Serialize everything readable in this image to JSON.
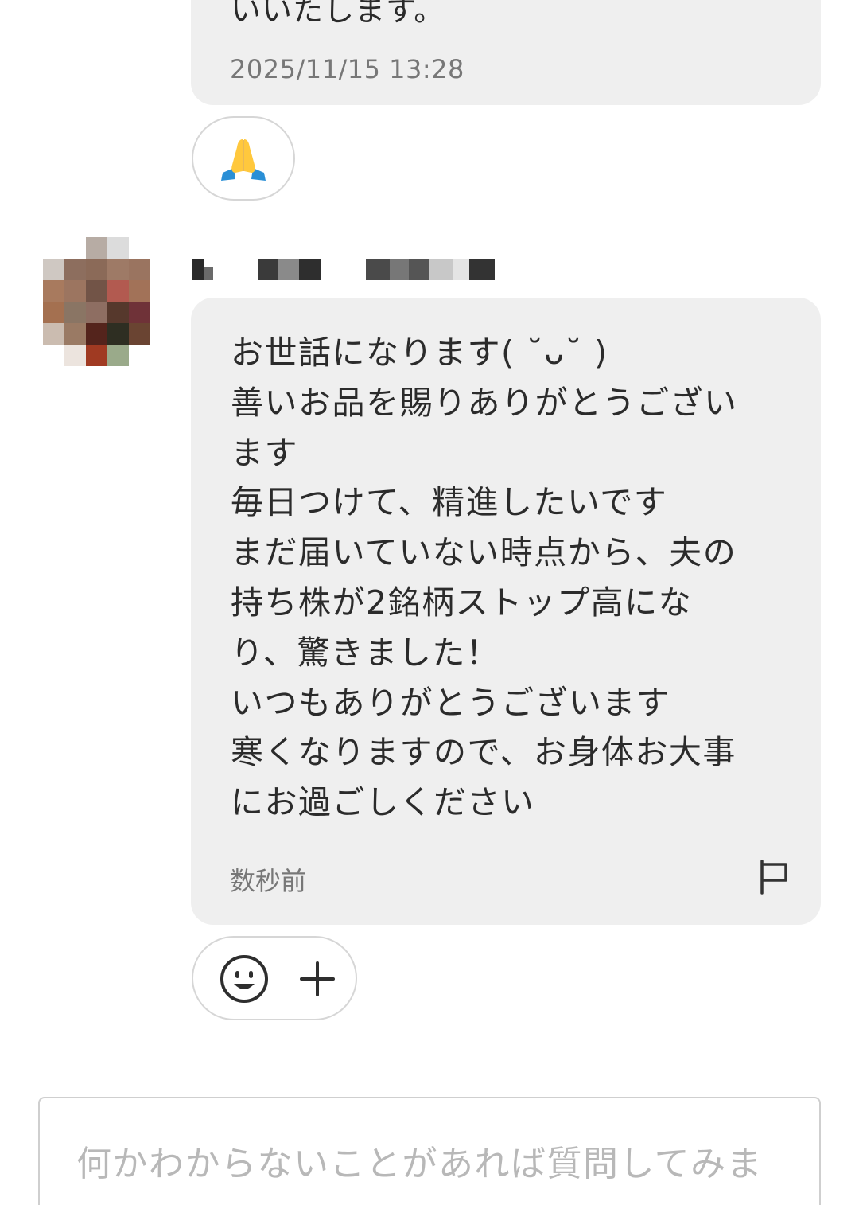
{
  "previous_message": {
    "text": "いいたします。",
    "timestamp": "2025/11/15 13:28"
  },
  "previous_reaction": {
    "emoji": "🙏"
  },
  "message": {
    "sender_name": "",
    "lines": [
      "お世話になります( ˘ᴗ˘ )",
      "善いお品を賜りありがとうござい",
      "ます",
      "毎日つけて、精進したいです",
      "まだ届いていない時点から、夫の",
      "持ち株が2銘柄ストップ高にな",
      "り、驚きました！",
      "いつもありがとうございます",
      "寒くなりますので、お身体お大事",
      "にお過ごしください"
    ],
    "timestamp": "数秒前",
    "report_icon": "flag-icon"
  },
  "reaction_controls": {
    "emoji_icon": "smiley-icon",
    "add_icon": "plus-icon"
  },
  "composer": {
    "placeholder": "何かわからないことがあれば質問してみま"
  },
  "colors": {
    "bubble_bg": "#efefef",
    "text": "#2b2b2b",
    "muted": "#777777",
    "border": "#d6d6d6",
    "placeholder": "#b8b8b8"
  }
}
